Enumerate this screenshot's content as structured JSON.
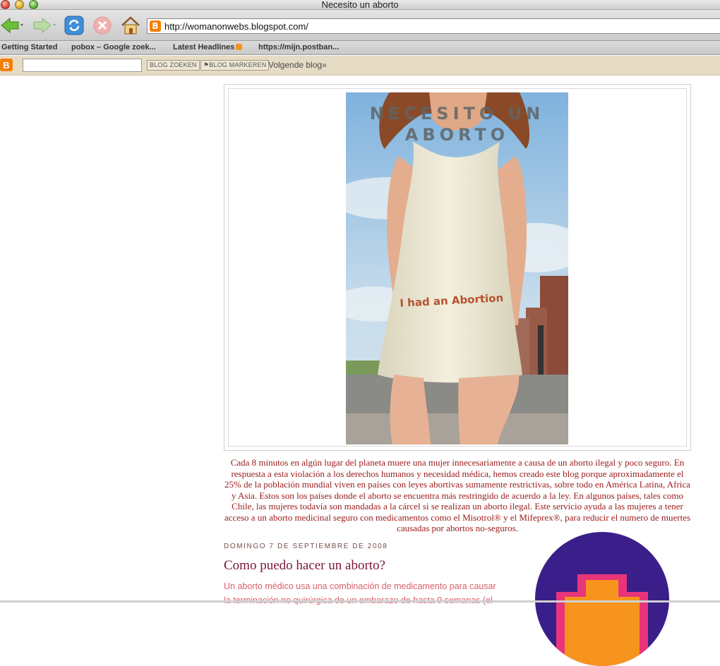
{
  "window": {
    "title": "Necesito un aborto"
  },
  "toolbar": {
    "url": "http://womanonwebs.blogspot.com/",
    "back_icon": "back-arrow-icon",
    "forward_icon": "forward-arrow-icon",
    "reload_icon": "reload-icon",
    "stop_icon": "stop-icon",
    "home_icon": "home-icon"
  },
  "bookmarks": [
    {
      "label": "Getting Started"
    },
    {
      "label": "pobox – Google zoek..."
    },
    {
      "label": "Latest Headlines"
    },
    {
      "label": "https://mijn.postban..."
    }
  ],
  "navbar": {
    "search_value": "",
    "search_button": "BLOG ZOEKEN",
    "flag_button": "BLOG MARKEREN",
    "next_blog": "Volgende blog»"
  },
  "header": {
    "blog_title": "NECESITO UN ABORTO",
    "shirt_text": "I had an Abortion"
  },
  "description": "Cada 8 minutos en algún lugar del planeta muere una mujer innecesariamente a causa de un aborto ilegal y poco seguro. En respuesta a esta violación a los derechos humanos y necesidad médica, hemos creado este blog porque aproximadamente el 25% de la población mundial viven en países con leyes abortivas sumamente restrictivas, sobre todo en América Latina, Africa y Asia. Estos son los países donde el aborto se encuentra más restringido de acuerdo a la ley. En algunos países, tales como Chile, las mujeres todavía son mandadas a la cárcel si se realizan un aborto ilegal. Este servicio ayuda a las mujeres a tener acceso a un aborto medicinal seguro con medicamentos como el Misotrol® y el Mifeprex®, para reducir el numero de muertes causadas por abortos no-seguros.",
  "post": {
    "date": "DOMINGO 7 DE SEPTIEMBRE DE 2008",
    "title": "Como puedo hacer un aborto?",
    "body_line1": "Un aborto médico usa una combinación de medicamento para causar",
    "body_line2": "la terminación no quirúrgica de un embarazo de hasta 9 semanas (el"
  },
  "colors": {
    "description": "#9b1a1a",
    "post_title": "#7b1538",
    "post_body": "#d8606a",
    "navbar": "#e6dcc5",
    "badge_bg": "#3a1f8a"
  }
}
